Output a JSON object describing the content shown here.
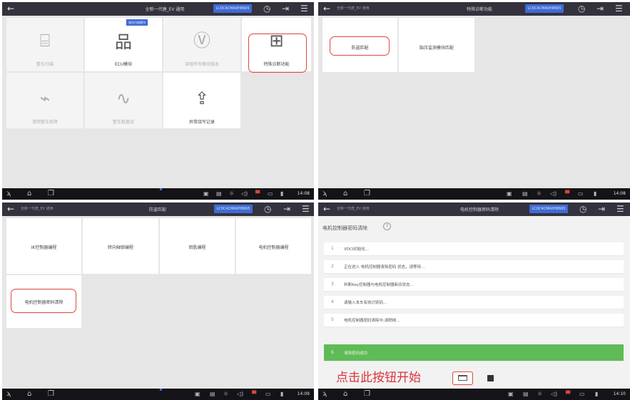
{
  "icons": {
    "back": "←",
    "clock": "◷",
    "logout": "⇥",
    "menu": "☰"
  },
  "panel1": {
    "title": "全新一代唐_EV 通用",
    "vin": "LC0C4CMA0H8665",
    "tiles": [
      {
        "label": "整车扫描",
        "icon": "scan-car-icon",
        "glyph": "⌸",
        "state": "disabled"
      },
      {
        "label": "ECU模块",
        "icon": "ecu-tree-icon",
        "glyph": "品",
        "state": "enabled",
        "tip": "请先扫描模块"
      },
      {
        "label": "读取所有模块版本",
        "icon": "version-v-icon",
        "glyph": "Ⓥ",
        "state": "disabled"
      },
      {
        "label": "特殊诊断功能",
        "icon": "medical-kit-icon",
        "glyph": "⊞",
        "state": "enabled"
      },
      {
        "label": "清除整车故障",
        "icon": "clear-fault-icon",
        "glyph": "⌁",
        "state": "disabled"
      },
      {
        "label": "整车数据流",
        "icon": "pulse-icon",
        "glyph": "∿",
        "state": "disabled"
      },
      {
        "label": "异常烧写记录",
        "icon": "upload-arrow-icon",
        "glyph": "⇪",
        "state": "enabled"
      }
    ],
    "time": "14:08"
  },
  "panel2": {
    "crumb": "全新一代唐_EV 通用",
    "title": "特殊诊断功能",
    "vin": "LC0C4CMA0H8665",
    "tiles": [
      {
        "label": "防盗匹配"
      },
      {
        "label": "胎压监测模块匹配"
      }
    ],
    "time": "14:08"
  },
  "panel3": {
    "crumb": "全新一代唐_EV 通用",
    "title": "防盗匹配",
    "vin": "LC0C4CMA0H8665",
    "tiles": [
      {
        "label": "IK控制器编程"
      },
      {
        "label": "转向轴锁编程"
      },
      {
        "label": "钥匙编程"
      },
      {
        "label": "电机控制器编程"
      },
      {
        "label": "电机控制器密码清除"
      }
    ],
    "time": "14:09"
  },
  "panel4": {
    "crumb": "全新一代唐_EV 通用",
    "title": "电机控制器密码清除",
    "vin": "LC0C4CMA0H8665",
    "heading": "电机控制器密码清除",
    "help": "?",
    "steps": [
      {
        "num": "1",
        "text": "VDCI初始化..."
      },
      {
        "num": "2",
        "text": "正在进入 电机控制器清除密码 状态，请等待..."
      },
      {
        "num": "3",
        "text": "判断Key控制器与电机控制器新旧状态..."
      },
      {
        "num": "4",
        "text": "请输入本车有效识别码..."
      },
      {
        "num": "5",
        "text": "电机控制器密码清除中,请稍候..."
      },
      {
        "num": "6",
        "text": "清除密码成功",
        "status": "success"
      }
    ],
    "instruction": "点击此按钮开始",
    "time": "14:10"
  }
}
